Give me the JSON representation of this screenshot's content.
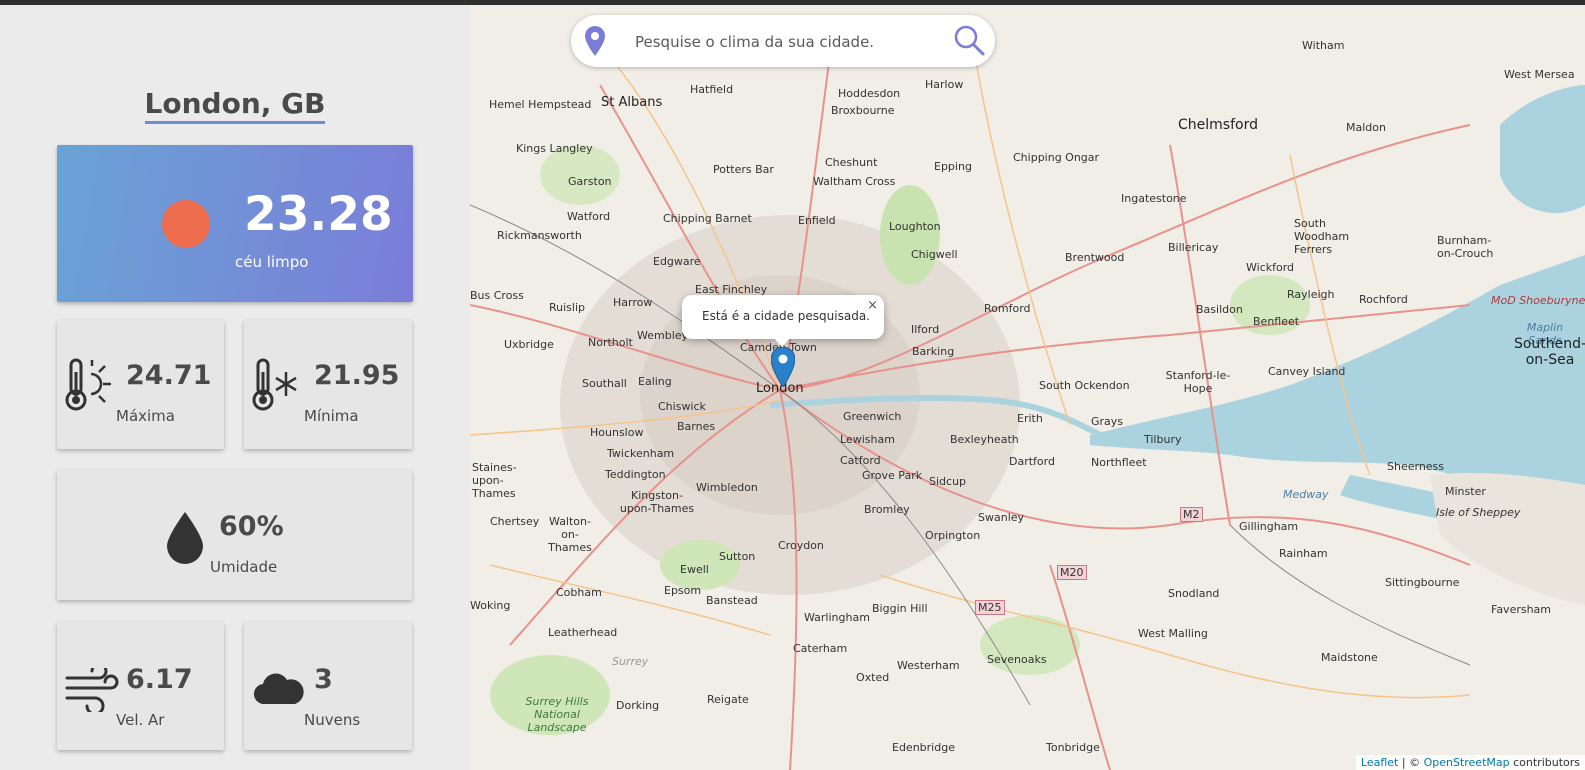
{
  "weather": {
    "city": "London, GB",
    "temperature": "23.28",
    "description": "céu limpo",
    "max_value": "24.71",
    "max_label": "Máxima",
    "min_value": "21.95",
    "min_label": "Mínima",
    "humidity_value": "60%",
    "humidity_label": "Umidade",
    "wind_value": "6.17",
    "wind_label": "Vel. Ar",
    "clouds_value": "3",
    "clouds_label": "Nuvens",
    "icons": [
      "sun-icon",
      "thermometer-hot-icon",
      "thermometer-cold-icon",
      "droplet-icon",
      "wind-icon",
      "cloud-icon"
    ],
    "colors": {
      "sun": "#ee6d4f",
      "card_gradient_start": "#6aa3d6",
      "card_gradient_end": "#7a7dd8"
    }
  },
  "search": {
    "placeholder": "Pesquise o clima da sua cidade.",
    "accent": "#7a7dd8"
  },
  "map": {
    "popup_text": "Está é a cidade pesquisada.",
    "popup_close": "×",
    "attribution_leaflet": "Leaflet",
    "attribution_sep": " | © ",
    "attribution_osm": "OpenStreetMap",
    "attribution_suffix": " contributors",
    "place_labels": {
      "london": "London",
      "st_albans": "St Albans",
      "chelmsford": "Chelmsford",
      "southend": "Southend-on-Sea",
      "hemel": "Hemel Hempstead",
      "hatfield": "Hatfield",
      "hoddesdon": "Hoddesdon",
      "harlow": "Harlow",
      "witham": "Witham",
      "maldon": "Maldon",
      "west_mersea": "West Mersea",
      "broxbourne": "Broxbourne",
      "kings_langley": "Kings Langley",
      "cheshunt": "Cheshunt",
      "potters_bar": "Potters Bar",
      "waltham_cross": "Waltham Cross",
      "epping": "Epping",
      "chipping_ongar": "Chipping Ongar",
      "garston": "Garston",
      "ingatestone": "Ingatestone",
      "watford": "Watford",
      "chipping_barnet": "Chipping Barnet",
      "enfield": "Enfield",
      "loughton": "Loughton",
      "south_woodham": "South Woodham Ferrers",
      "burnham": "Burnham-on-Crouch",
      "rickmansworth": "Rickmansworth",
      "billericay": "Billericay",
      "chigwell": "Chigwell",
      "edgware": "Edgware",
      "brentwood": "Brentwood",
      "wickford": "Wickford",
      "rayleigh": "Rayleigh",
      "rochford": "Rochford",
      "mod_shoebury": "MoD Shoeburyness",
      "ruislip": "Ruislip",
      "harrow": "Harrow",
      "east_finchley": "East Finchley",
      "romford": "Romford",
      "basildon": "Basildon",
      "benfleet": "Benfleet",
      "maplin_sands": "Maplin Sands",
      "uxbridge": "Uxbridge",
      "northolt": "Northolt",
      "wembley": "Wembley",
      "camden": "Camden Town",
      "ilford": "Ilford",
      "barking": "Barking",
      "stanford": "Stanford-le-Hope",
      "canvey": "Canvey Island",
      "southall": "Southall",
      "ealing": "Ealing",
      "south_ockendon": "South Ockendon",
      "chiswick": "Chiswick",
      "greenwich": "Greenwich",
      "erith": "Erith",
      "barnes": "Barnes",
      "hounslow": "Hounslow",
      "lewisham": "Lewisham",
      "bexleyheath": "Bexleyheath",
      "grays": "Grays",
      "tilbury": "Tilbury",
      "twickenham": "Twickenham",
      "catford": "Catford",
      "dartford": "Dartford",
      "northfleet": "Northfleet",
      "staines": "Staines-upon-Thames",
      "teddington": "Teddington",
      "wimbledon": "Wimbledon",
      "kingston": "Kingston-upon-Thames",
      "grove_park": "Grove Park",
      "sidcup": "Sidcup",
      "sheerness": "Sheerness",
      "minster": "Minster",
      "medway": "Medway",
      "isle_sheppey": "Isle of Sheppey",
      "bromley": "Bromley",
      "swanley": "Swanley",
      "chertsey": "Chertsey",
      "walton": "Walton-on-Thames",
      "m2": "M2",
      "gillingham": "Gillingham",
      "orpington": "Orpington",
      "rainham": "Rainham",
      "croydon": "Croydon",
      "sutton": "Sutton",
      "ewell": "Ewell",
      "m20": "M20",
      "sittingbourne": "Sittingbourne",
      "cobham": "Cobham",
      "epsom": "Epsom",
      "banstead": "Banstead",
      "snodland": "Snodland",
      "m25": "M25",
      "biggin_hill": "Biggin Hill",
      "faversham": "Faversham",
      "leatherhead": "Leatherhead",
      "warlingham": "Warlingham",
      "west_malling": "West Malling",
      "caterham": "Caterham",
      "sevenoaks": "Sevenoaks",
      "maidstone": "Maidstone",
      "westerham": "Westerham",
      "surrey": "Surrey",
      "oxted": "Oxted",
      "reigate": "Reigate",
      "dorking": "Dorking",
      "surrey_hills": "Surrey Hills National Landscape",
      "edenbridge": "Edenbridge",
      "tonbridge": "Tonbridge",
      "bus_cross": "Bus Cross",
      "woking": "Woking"
    }
  }
}
